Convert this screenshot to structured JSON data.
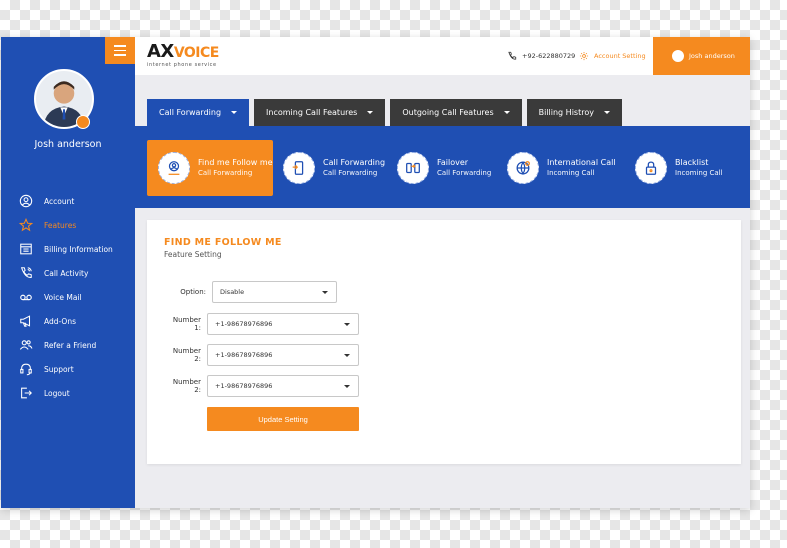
{
  "brand": {
    "logo_ax": "AX",
    "logo_voice": "VOICE",
    "tagline": "internet phone service"
  },
  "header": {
    "phone": "+92-622880729",
    "account_setting": "Account Setting",
    "user_name": "Josh anderson"
  },
  "sidebar": {
    "profile_name": "Josh anderson",
    "items": [
      {
        "label": "Account",
        "icon": "user-icon"
      },
      {
        "label": "Features",
        "icon": "star-icon"
      },
      {
        "label": "Billing Information",
        "icon": "receipt-icon"
      },
      {
        "label": "Call Activity",
        "icon": "phone-icon"
      },
      {
        "label": "Voice Mail",
        "icon": "voicemail-icon"
      },
      {
        "label": "Add-Ons",
        "icon": "megaphone-icon"
      },
      {
        "label": "Refer a Friend",
        "icon": "users-icon"
      },
      {
        "label": "Support",
        "icon": "headset-icon"
      },
      {
        "label": "Logout",
        "icon": "logout-icon"
      }
    ],
    "active_index": 1
  },
  "tabs": [
    {
      "label": "Call Forwarding"
    },
    {
      "label": "Incoming Call Features"
    },
    {
      "label": "Outgoing Call Features"
    },
    {
      "label": "Billing Histroy"
    }
  ],
  "features": [
    {
      "title": "Find me Follow me",
      "sub": "Call Forwarding",
      "icon": "person-search-icon"
    },
    {
      "title": "Call Forwarding",
      "sub": "Call Forwarding",
      "icon": "mobile-forward-icon"
    },
    {
      "title": "Failover",
      "sub": "Call Forwarding",
      "icon": "failover-icon"
    },
    {
      "title": "International Call",
      "sub": "Incoming Call",
      "icon": "globe-icon"
    },
    {
      "title": "Blacklist",
      "sub": "Incoming Call",
      "icon": "lock-icon"
    }
  ],
  "form": {
    "title": "FIND ME FOLLOW ME",
    "subtitle": "Feature Setting",
    "option_label": "Option:",
    "option_value": "Disable",
    "numbers": [
      {
        "label": "Number 1:",
        "value": "+1-98678976896"
      },
      {
        "label": "Number 2:",
        "value": "+1-98678976896"
      },
      {
        "label": "Number 2:",
        "value": "+1-98678976896"
      }
    ],
    "submit_label": "Update Setting"
  },
  "colors": {
    "primary": "#1f4fb3",
    "accent": "#f58a1f",
    "tab_dark": "#3a3a3a"
  }
}
